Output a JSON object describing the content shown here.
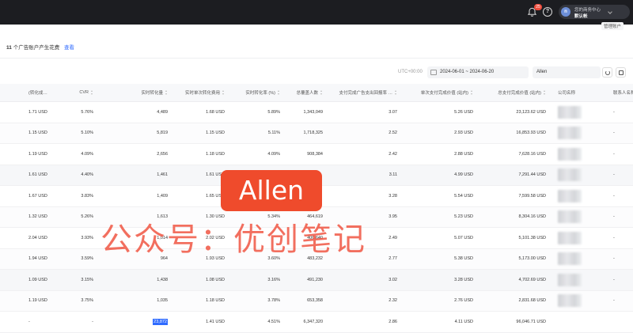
{
  "topbar": {
    "notification_count": "25",
    "help_glyph": "?",
    "avatar_letter": "n",
    "profile_line1": "您的商务中心",
    "profile_line2": "默认帐"
  },
  "toolbar": {
    "switch_account": "管理账户",
    "summary_count": "11",
    "summary_text": "个广告账户产生花费",
    "summary_link": "查看",
    "timezone": "UTC+00:00",
    "date_range": "2024-06-01 ~ 2024-06-20",
    "account_filter": "Allen"
  },
  "table": {
    "headers": [
      "(转化成…",
      "CVR",
      "实时转化量",
      "实时单次转化费用",
      "实时转化率 (%)",
      "总覆盖人数",
      "支付完成广告支出回报率 …",
      "单次支付完成价值 (站内)",
      "总支付完成价值 (站内)",
      "公司名称",
      "联系人名称"
    ],
    "rows": [
      [
        "1.71 USD",
        "5.76%",
        "4,489",
        "1.68 USD",
        "5.89%",
        "1,343,049",
        "3.07",
        "5.26 USD",
        "23,123.62 USD",
        "",
        "-"
      ],
      [
        "1.15 USD",
        "5.10%",
        "5,819",
        "1.15 USD",
        "5.11%",
        "1,718,325",
        "2.52",
        "2.93 USD",
        "16,853.93 USD",
        "",
        "-"
      ],
      [
        "1.19 USD",
        "4.09%",
        "2,656",
        "1.18 USD",
        "4.09%",
        "908,384",
        "2.42",
        "2.88 USD",
        "7,628.16 USD",
        "",
        "-"
      ],
      [
        "1.61 USD",
        "4.40%",
        "1,461",
        "1.61 USD",
        "",
        "",
        "3.11",
        "4.99 USD",
        "7,291.44 USD",
        "",
        "-"
      ],
      [
        "1.67 USD",
        "3.83%",
        "1,409",
        "1.65 USD",
        "",
        "",
        "3.28",
        "5.54 USD",
        "7,599.58 USD",
        "",
        "-"
      ],
      [
        "1.32 USD",
        "5.26%",
        "1,613",
        "1.30 USD",
        "5.34%",
        "464,619",
        "3.95",
        "5.23 USD",
        "8,304.16 USD",
        "",
        "-"
      ],
      [
        "2.04 USD",
        "3.93%",
        "1,014",
        "2.02 USD",
        "",
        "406,640",
        "2.49",
        "5.07 USD",
        "5,101.38 USD",
        "",
        "-"
      ],
      [
        "1.94 USD",
        "3.59%",
        "964",
        "1.93 USD",
        "3.60%",
        "483,232",
        "2.77",
        "5.38 USD",
        "5,173.00 USD",
        "",
        "-"
      ],
      [
        "1.09 USD",
        "3.15%",
        "1,438",
        "1.08 USD",
        "3.16%",
        "491,230",
        "3.02",
        "3.28 USD",
        "4,702.69 USD",
        "",
        "-"
      ],
      [
        "1.19 USD",
        "3.75%",
        "1,035",
        "1.18 USD",
        "3.78%",
        "653,358",
        "2.32",
        "2.76 USD",
        "2,831.68 USD",
        "",
        "-"
      ],
      [
        "-",
        "-",
        "23,872",
        "1.41 USD",
        "4.51%",
        "6,347,320",
        "2.86",
        "4.11 USD",
        "96,046.71 USD",
        "",
        ""
      ]
    ]
  },
  "watermark": {
    "stamp": "Allen",
    "text": "公众号：优创笔记"
  }
}
